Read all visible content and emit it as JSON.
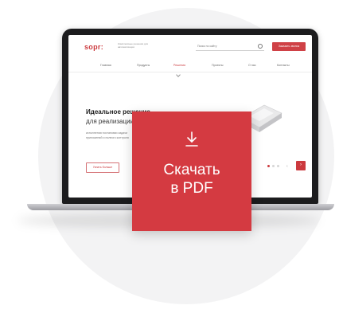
{
  "site": {
    "logo": "sopr:",
    "tagline": "Комплексные решения для автоматизации",
    "search_placeholder": "Поиск по сайту",
    "header_button": "Заказать звонок",
    "nav": [
      "Главная",
      "Продукты",
      "Решения",
      "Проекты",
      "О нас",
      "Контакты"
    ],
    "nav_active_index": 2
  },
  "hero": {
    "title": "Идеальное решение",
    "subtitle": "для реализации",
    "text": "исполнения постановки задачи приложений и полного контроля",
    "button": "Узнать больше",
    "slide_index": 0,
    "slide_count": 3,
    "next_arrow": "›",
    "prev_arrow": "‹"
  },
  "download": {
    "icon": "download-icon",
    "label_line1": "Скачать",
    "label_line2": "в PDF"
  },
  "colors": {
    "brand_red": "#d43a41",
    "background": "#ffffff",
    "circle": "#f3f3f4"
  }
}
